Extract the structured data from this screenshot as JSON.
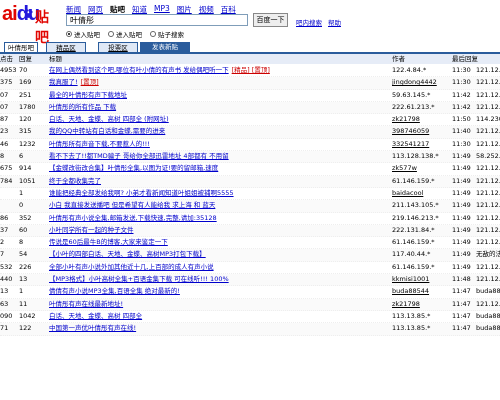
{
  "logo": {
    "text_ai": "ai",
    "text_du": "du",
    "text_tieba": "贴吧"
  },
  "topnav": [
    "新闻",
    "网页",
    "贴吧",
    "知道",
    "MP3",
    "图片",
    "视频",
    "百科"
  ],
  "topnav_active": 2,
  "search": {
    "value": "叶倩彤",
    "button": "百度一下",
    "help1": "吧内搜索",
    "help2": "帮助"
  },
  "radios": [
    {
      "label": "进入贴吧",
      "checked": true
    },
    {
      "label": "进入贴吧",
      "checked": false
    },
    {
      "label": "贴子搜索",
      "checked": false
    }
  ],
  "tabs": [
    "叶倩彤吧",
    "精品区",
    "投票区",
    "发表新贴"
  ],
  "headers": {
    "click": "点击",
    "reply": "回复",
    "title": "标题",
    "author": "作者",
    "last": "最后回复"
  },
  "rows": [
    {
      "click": "4953",
      "reply": "70",
      "title": "在网上偶然看到这个吧,哪位有叶小倩的有声书 发给偶吧听一下",
      "tags": "[精品] [置顶]",
      "author": "122.4.84.*",
      "time": "11:30",
      "last": "121.12."
    },
    {
      "click": "375",
      "reply": "169",
      "title": "我真服了!",
      "tags": "[置顶]",
      "author": "jingdong4442",
      "time": "11:30",
      "last": "121.12."
    },
    {
      "click": "07",
      "reply": "251",
      "title": "最全的叶倩彤有声下载地址",
      "tags": "",
      "author": "59.63.145.*",
      "time": "11:42",
      "last": "121.12."
    },
    {
      "click": "07",
      "reply": "1780",
      "title": "叶倩彤的所有作品 下载",
      "tags": "",
      "author": "222.61.213.*",
      "time": "11:42",
      "last": "121.12."
    },
    {
      "click": "87",
      "reply": "120",
      "title": "白话、天地、金蝶、高树 四部全 (附网址)",
      "tags": "",
      "author": "zk21798",
      "time": "11:50",
      "last": "114.230."
    },
    {
      "click": "23",
      "reply": "315",
      "title": "我的QQ中转站有白话和金蝶,需要的进来",
      "tags": "",
      "author": "398746059",
      "time": "11:40",
      "last": "121.12."
    },
    {
      "click": "46",
      "reply": "1232",
      "title": "叶倩彤所有声音下载,不要惹人的!!!",
      "tags": "",
      "author": "332541217",
      "time": "11:30",
      "last": "121.12."
    },
    {
      "click": "8",
      "reply": "6",
      "title": "看不下去了!!都TMD骗子 哥给你全部迅雷地址 4部都有 不用留",
      "tags": "",
      "author": "113.128.138.*",
      "time": "11:49",
      "last": "58.252.1"
    },
    {
      "click": "675",
      "reply": "914",
      "title": "【金蝶改街改合集】叶倩彤全集,以图为证!要的留邮箱,速度",
      "tags": "",
      "author": "zk577w",
      "time": "11:49",
      "last": "121.12."
    },
    {
      "click": "784",
      "reply": "1051",
      "title": "终于全都收集完了",
      "tags": "",
      "author": "61.146.159.*",
      "time": "11:49",
      "last": "121.12."
    },
    {
      "click": "",
      "reply": "1",
      "title": "谁能把经典全部发给我啊? 小弟才看新闻知道叶姐姐被捕啊5555",
      "tags": "",
      "author": "baidacool",
      "time": "11:49",
      "last": "121.12."
    },
    {
      "click": "",
      "reply": "0",
      "title": "小白 我直接发送播吧 但是希望有人能给我 求上海 和 蓝天",
      "tags": "",
      "author": "211.143.105.*",
      "time": "11:49",
      "last": "121.12."
    },
    {
      "click": "86",
      "reply": "352",
      "title": "叶倩彤有声小说全集,邮箱发送,下载快速,完整,请加:35128",
      "tags": "",
      "author": "219.146.213.*",
      "time": "11:49",
      "last": "121.12."
    },
    {
      "click": "37",
      "reply": "60",
      "title": "小叶同学所有一起的种子文件",
      "tags": "",
      "author": "222.131.84.*",
      "time": "11:49",
      "last": "121.12."
    },
    {
      "click": "2",
      "reply": "8",
      "title": "传说是60后最牛B的博客,大家来鉴定一下",
      "tags": "",
      "author": "61.146.159.*",
      "time": "11:49",
      "last": "121.12."
    },
    {
      "click": "7",
      "reply": "54",
      "title": "【小叶的四部白话、天地、金蝶、高树MP3打包下载】",
      "tags": "",
      "author": "117.40.44.*",
      "time": "11:49",
      "last": "无敌的法"
    },
    {
      "click": "532",
      "reply": "226",
      "title": "全部小叶有声小说外加其他近十几,上百部的成人有声小说",
      "tags": "",
      "author": "61.146.159.*",
      "time": "11:49",
      "last": "121.12."
    },
    {
      "click": "440",
      "reply": "13",
      "title": "【MP3格式】小叶高树全集+百语金集下载 可在线听!!! 100%",
      "tags": "",
      "author": "kkmisi1001",
      "time": "11:48",
      "last": "121.12."
    },
    {
      "click": "13",
      "reply": "1",
      "title": "倩倩有声小说MP3全集,百语全集 绝对最新的!",
      "tags": "",
      "author": "buda88544",
      "time": "11:47",
      "last": "buda885"
    },
    {
      "click": "63",
      "reply": "11",
      "title": "叶倩彤有声在线最新地址!",
      "tags": "",
      "author": "zk21798",
      "time": "11:47",
      "last": "121.12."
    },
    {
      "click": "090",
      "reply": "1042",
      "title": "白话、天地、金蝶、高树 四部全",
      "tags": "",
      "author": "113.13.85.*",
      "time": "11:47",
      "last": "buda885"
    },
    {
      "click": "71",
      "reply": "122",
      "title": "中国第一声优叶倩彤有声在线!",
      "tags": "",
      "author": "113.13.85.*",
      "time": "11:47",
      "last": "buda885"
    }
  ]
}
